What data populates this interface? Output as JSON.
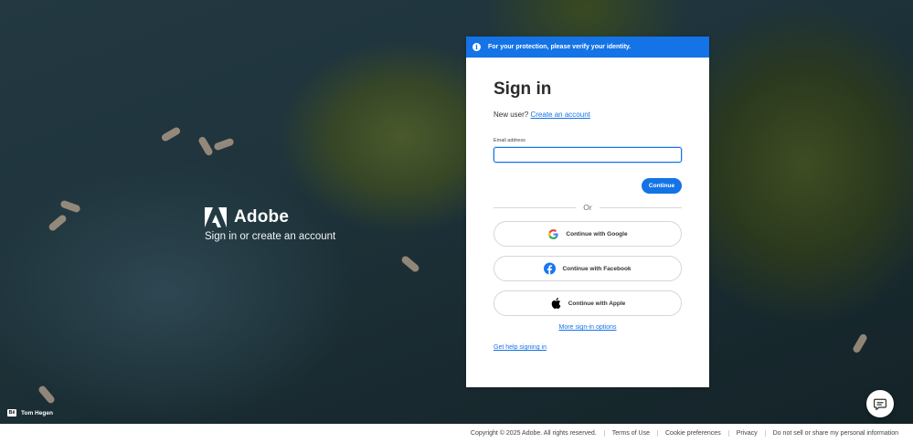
{
  "brand": {
    "name": "Adobe",
    "tagline": "Sign in or create an account",
    "photo_credit": "Tom Hegen",
    "photo_credit_badge": "Bē"
  },
  "banner": {
    "icon": "info-icon",
    "text": "For your protection, please verify your identity."
  },
  "signin": {
    "title": "Sign in",
    "new_user_text": "New user?",
    "create_account_link": "Create an account",
    "email_label": "Email address",
    "email_value": "",
    "continue_label": "Continue",
    "or_text": "Or",
    "google_label": "Continue with Google",
    "facebook_label": "Continue with Facebook",
    "apple_label": "Continue with Apple",
    "more_options_link": "More sign-in options",
    "help_link": "Get help signing in"
  },
  "footer": {
    "copyright": "Copyright © 2025 Adobe. All rights reserved.",
    "links": [
      "Terms of Use",
      "Cookie preferences",
      "Privacy",
      "Do not sell or share my personal information"
    ]
  },
  "colors": {
    "accent": "#1473e6",
    "facebook": "#1877f2"
  }
}
